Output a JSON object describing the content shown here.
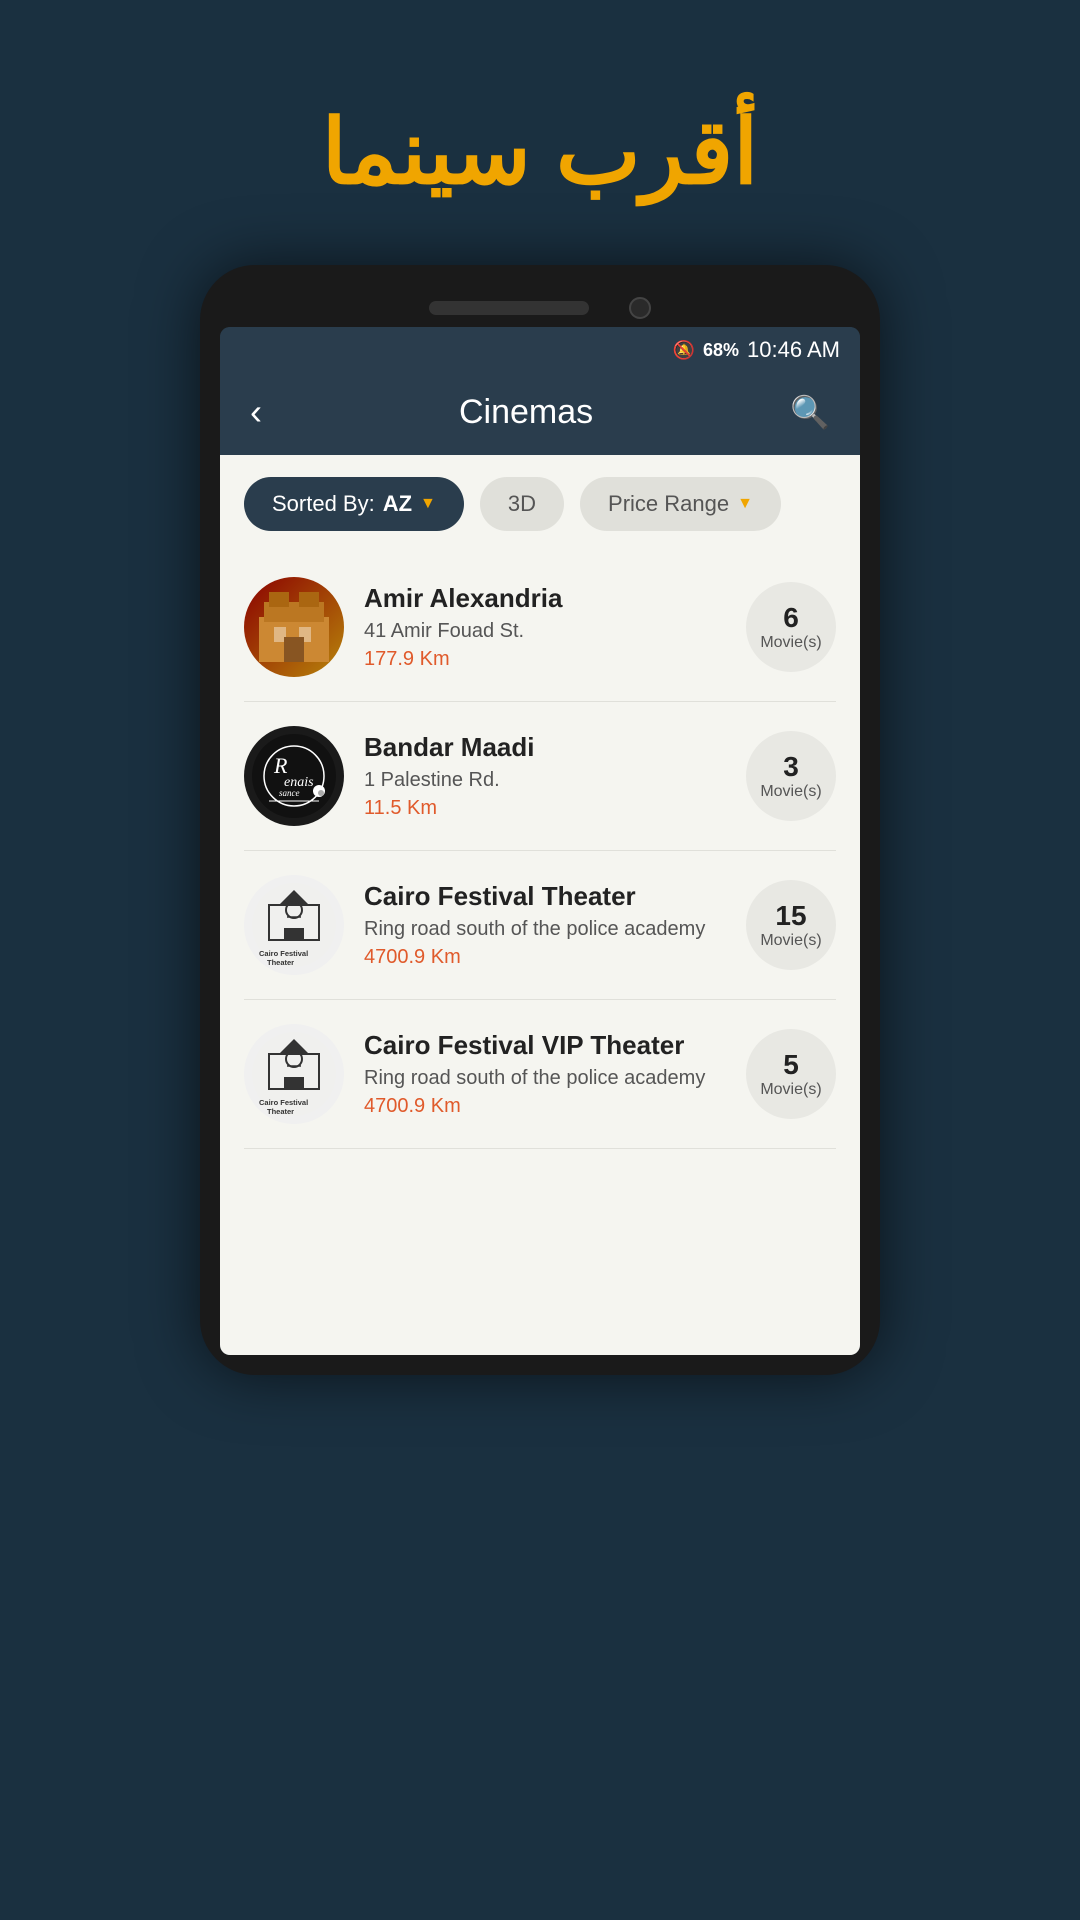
{
  "page": {
    "title_arabic": "أقرب سينما",
    "background_color": "#1a3040"
  },
  "status_bar": {
    "battery": "68%",
    "time": "10:46 AM"
  },
  "header": {
    "back_label": "‹",
    "title": "Cinemas",
    "search_icon": "🔍"
  },
  "filters": [
    {
      "id": "sort-az",
      "label": "Sorted By:",
      "value": "AZ",
      "active": true
    },
    {
      "id": "filter-3d",
      "label": "3D",
      "active": false
    },
    {
      "id": "filter-price",
      "label": "Price Range",
      "active": false
    }
  ],
  "cinemas": [
    {
      "id": "amir-alexandria",
      "name": "Amir Alexandria",
      "address": "41 Amir Fouad St.",
      "distance": "177.9 Km",
      "movies": 6,
      "logo_type": "building"
    },
    {
      "id": "bandar-maadi",
      "name": "Bandar Maadi",
      "address": "1 Palestine Rd.",
      "distance": "11.5 Km",
      "movies": 3,
      "logo_type": "renaissance"
    },
    {
      "id": "cairo-festival-theater",
      "name": "Cairo Festival Theater",
      "address": "Ring road south of the police academy",
      "distance": "4700.9 Km",
      "movies": 15,
      "logo_type": "cft"
    },
    {
      "id": "cairo-festival-vip",
      "name": "Cairo Festival VIP Theater",
      "address": "Ring road south of the police academy",
      "distance": "4700.9 Km",
      "movies": 5,
      "logo_type": "cft"
    }
  ],
  "labels": {
    "movies_label": "Movie(s)",
    "sorted_by": "Sorted By:",
    "sort_value": "AZ"
  }
}
